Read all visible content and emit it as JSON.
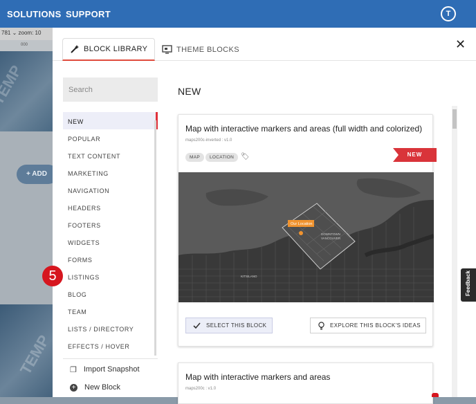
{
  "topbar": {
    "solutions": "SOLUTIONS",
    "support": "SUPPORT",
    "avatar_initial": "T"
  },
  "editor_bg": {
    "toolbar_value": "781",
    "zoom_label": "zoom: 10",
    "ruler_mark": "000",
    "add_label": "+ ADD"
  },
  "modal": {
    "tabs": [
      {
        "label": "BLOCK LIBRARY",
        "icon": "magic-wand-icon",
        "active": true
      },
      {
        "label": "THEME BLOCKS",
        "icon": "theme-blocks-icon",
        "active": false
      }
    ],
    "close_icon": "close-icon",
    "search": {
      "placeholder": "Search"
    },
    "categories": [
      "NEW",
      "POPULAR",
      "TEXT CONTENT",
      "MARKETING",
      "NAVIGATION",
      "HEADERS",
      "FOOTERS",
      "WIDGETS",
      "FORMS",
      "LISTINGS",
      "BLOG",
      "TEAM",
      "LISTS / DIRECTORY",
      "EFFECTS / HOVER"
    ],
    "active_category": "NEW",
    "actions": [
      {
        "label": "Import Snapshot",
        "icon": "copy-icon"
      },
      {
        "label": "New Block",
        "icon": "plus-circle-icon"
      }
    ],
    "section_heading": "NEW",
    "cards": [
      {
        "title": "Map with interactive markers and areas (full width and colorized)",
        "subtitle": "maps200c-inverted : v1.0",
        "chips": [
          "MAP",
          "LOCATION"
        ],
        "ribbon": "NEW",
        "map_labels": {
          "our_location": "Our Location",
          "downtown": "DOWNTOWN",
          "vancouver": "VANCOUVER",
          "kitsilano": "KITSILANO"
        },
        "select_label": "SELECT THIS BLOCK",
        "explore_label": "EXPLORE THIS BLOCK'S IDEAS"
      },
      {
        "title": "Map with interactive markers and areas",
        "subtitle": "maps200c : v1.0"
      }
    ]
  },
  "step_badge": "5",
  "feedback": "Feedback",
  "colors": {
    "topbar": "#2f6db5",
    "accent_red": "#d9343a",
    "active_cat_bg": "#edeef8"
  }
}
